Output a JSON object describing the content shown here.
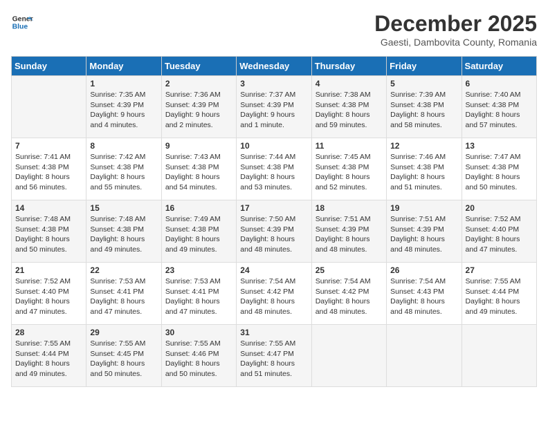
{
  "header": {
    "logo_line1": "General",
    "logo_line2": "Blue",
    "month_year": "December 2025",
    "location": "Gaesti, Dambovita County, Romania"
  },
  "days_of_week": [
    "Sunday",
    "Monday",
    "Tuesday",
    "Wednesday",
    "Thursday",
    "Friday",
    "Saturday"
  ],
  "weeks": [
    [
      {
        "day": "",
        "sunrise": "",
        "sunset": "",
        "daylight": ""
      },
      {
        "day": "1",
        "sunrise": "Sunrise: 7:35 AM",
        "sunset": "Sunset: 4:39 PM",
        "daylight": "Daylight: 9 hours and 4 minutes."
      },
      {
        "day": "2",
        "sunrise": "Sunrise: 7:36 AM",
        "sunset": "Sunset: 4:39 PM",
        "daylight": "Daylight: 9 hours and 2 minutes."
      },
      {
        "day": "3",
        "sunrise": "Sunrise: 7:37 AM",
        "sunset": "Sunset: 4:39 PM",
        "daylight": "Daylight: 9 hours and 1 minute."
      },
      {
        "day": "4",
        "sunrise": "Sunrise: 7:38 AM",
        "sunset": "Sunset: 4:38 PM",
        "daylight": "Daylight: 8 hours and 59 minutes."
      },
      {
        "day": "5",
        "sunrise": "Sunrise: 7:39 AM",
        "sunset": "Sunset: 4:38 PM",
        "daylight": "Daylight: 8 hours and 58 minutes."
      },
      {
        "day": "6",
        "sunrise": "Sunrise: 7:40 AM",
        "sunset": "Sunset: 4:38 PM",
        "daylight": "Daylight: 8 hours and 57 minutes."
      }
    ],
    [
      {
        "day": "7",
        "sunrise": "Sunrise: 7:41 AM",
        "sunset": "Sunset: 4:38 PM",
        "daylight": "Daylight: 8 hours and 56 minutes."
      },
      {
        "day": "8",
        "sunrise": "Sunrise: 7:42 AM",
        "sunset": "Sunset: 4:38 PM",
        "daylight": "Daylight: 8 hours and 55 minutes."
      },
      {
        "day": "9",
        "sunrise": "Sunrise: 7:43 AM",
        "sunset": "Sunset: 4:38 PM",
        "daylight": "Daylight: 8 hours and 54 minutes."
      },
      {
        "day": "10",
        "sunrise": "Sunrise: 7:44 AM",
        "sunset": "Sunset: 4:38 PM",
        "daylight": "Daylight: 8 hours and 53 minutes."
      },
      {
        "day": "11",
        "sunrise": "Sunrise: 7:45 AM",
        "sunset": "Sunset: 4:38 PM",
        "daylight": "Daylight: 8 hours and 52 minutes."
      },
      {
        "day": "12",
        "sunrise": "Sunrise: 7:46 AM",
        "sunset": "Sunset: 4:38 PM",
        "daylight": "Daylight: 8 hours and 51 minutes."
      },
      {
        "day": "13",
        "sunrise": "Sunrise: 7:47 AM",
        "sunset": "Sunset: 4:38 PM",
        "daylight": "Daylight: 8 hours and 50 minutes."
      }
    ],
    [
      {
        "day": "14",
        "sunrise": "Sunrise: 7:48 AM",
        "sunset": "Sunset: 4:38 PM",
        "daylight": "Daylight: 8 hours and 50 minutes."
      },
      {
        "day": "15",
        "sunrise": "Sunrise: 7:48 AM",
        "sunset": "Sunset: 4:38 PM",
        "daylight": "Daylight: 8 hours and 49 minutes."
      },
      {
        "day": "16",
        "sunrise": "Sunrise: 7:49 AM",
        "sunset": "Sunset: 4:38 PM",
        "daylight": "Daylight: 8 hours and 49 minutes."
      },
      {
        "day": "17",
        "sunrise": "Sunrise: 7:50 AM",
        "sunset": "Sunset: 4:39 PM",
        "daylight": "Daylight: 8 hours and 48 minutes."
      },
      {
        "day": "18",
        "sunrise": "Sunrise: 7:51 AM",
        "sunset": "Sunset: 4:39 PM",
        "daylight": "Daylight: 8 hours and 48 minutes."
      },
      {
        "day": "19",
        "sunrise": "Sunrise: 7:51 AM",
        "sunset": "Sunset: 4:39 PM",
        "daylight": "Daylight: 8 hours and 48 minutes."
      },
      {
        "day": "20",
        "sunrise": "Sunrise: 7:52 AM",
        "sunset": "Sunset: 4:40 PM",
        "daylight": "Daylight: 8 hours and 47 minutes."
      }
    ],
    [
      {
        "day": "21",
        "sunrise": "Sunrise: 7:52 AM",
        "sunset": "Sunset: 4:40 PM",
        "daylight": "Daylight: 8 hours and 47 minutes."
      },
      {
        "day": "22",
        "sunrise": "Sunrise: 7:53 AM",
        "sunset": "Sunset: 4:41 PM",
        "daylight": "Daylight: 8 hours and 47 minutes."
      },
      {
        "day": "23",
        "sunrise": "Sunrise: 7:53 AM",
        "sunset": "Sunset: 4:41 PM",
        "daylight": "Daylight: 8 hours and 47 minutes."
      },
      {
        "day": "24",
        "sunrise": "Sunrise: 7:54 AM",
        "sunset": "Sunset: 4:42 PM",
        "daylight": "Daylight: 8 hours and 48 minutes."
      },
      {
        "day": "25",
        "sunrise": "Sunrise: 7:54 AM",
        "sunset": "Sunset: 4:42 PM",
        "daylight": "Daylight: 8 hours and 48 minutes."
      },
      {
        "day": "26",
        "sunrise": "Sunrise: 7:54 AM",
        "sunset": "Sunset: 4:43 PM",
        "daylight": "Daylight: 8 hours and 48 minutes."
      },
      {
        "day": "27",
        "sunrise": "Sunrise: 7:55 AM",
        "sunset": "Sunset: 4:44 PM",
        "daylight": "Daylight: 8 hours and 49 minutes."
      }
    ],
    [
      {
        "day": "28",
        "sunrise": "Sunrise: 7:55 AM",
        "sunset": "Sunset: 4:44 PM",
        "daylight": "Daylight: 8 hours and 49 minutes."
      },
      {
        "day": "29",
        "sunrise": "Sunrise: 7:55 AM",
        "sunset": "Sunset: 4:45 PM",
        "daylight": "Daylight: 8 hours and 50 minutes."
      },
      {
        "day": "30",
        "sunrise": "Sunrise: 7:55 AM",
        "sunset": "Sunset: 4:46 PM",
        "daylight": "Daylight: 8 hours and 50 minutes."
      },
      {
        "day": "31",
        "sunrise": "Sunrise: 7:55 AM",
        "sunset": "Sunset: 4:47 PM",
        "daylight": "Daylight: 8 hours and 51 minutes."
      },
      {
        "day": "",
        "sunrise": "",
        "sunset": "",
        "daylight": ""
      },
      {
        "day": "",
        "sunrise": "",
        "sunset": "",
        "daylight": ""
      },
      {
        "day": "",
        "sunrise": "",
        "sunset": "",
        "daylight": ""
      }
    ]
  ]
}
